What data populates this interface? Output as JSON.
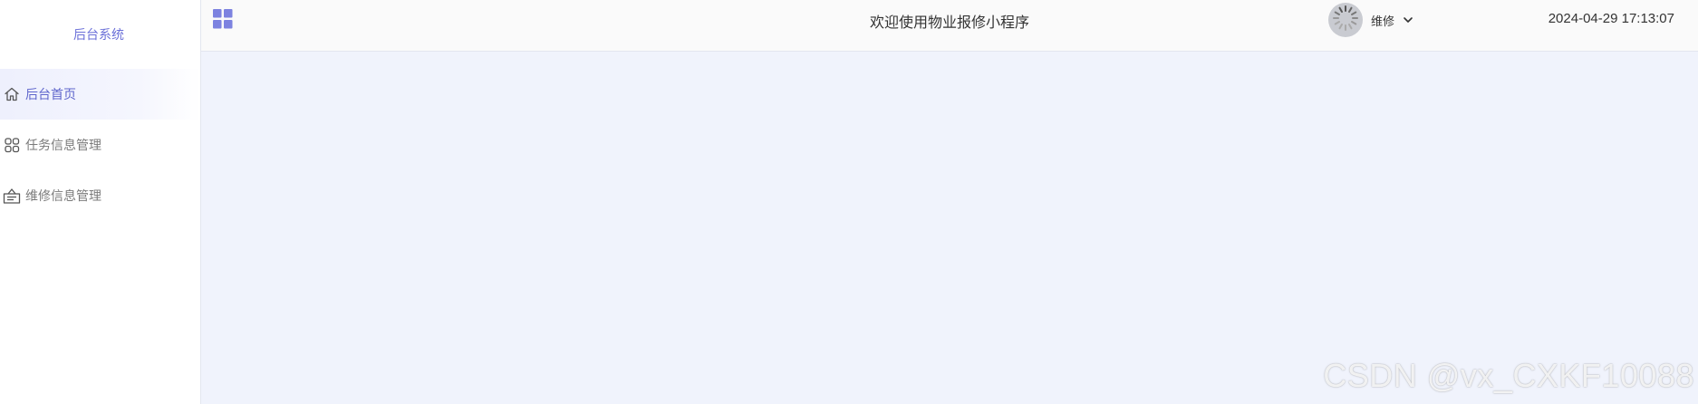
{
  "sidebar": {
    "logo_text": "后台系统",
    "items": [
      {
        "label": "后台首页",
        "icon": "home-icon",
        "active": true
      },
      {
        "label": "任务信息管理",
        "icon": "grid-icon",
        "active": false
      },
      {
        "label": "维修信息管理",
        "icon": "inbox-icon",
        "active": false
      }
    ]
  },
  "header": {
    "toggle_icon": "apps-grid-icon",
    "title": "欢迎使用物业报修小程序",
    "user": {
      "name": "维修",
      "avatar_icon": "loading-spinner-icon",
      "dropdown_icon": "chevron-down-icon"
    },
    "datetime": "2024-04-29 17:13:07"
  },
  "watermark": "CSDN @vx_CXKF10088",
  "colors": {
    "accent": "#6a6fd8",
    "content_bg": "#f0f3fc",
    "header_bg": "#fafafa",
    "sidebar_bg": "#ffffff"
  }
}
